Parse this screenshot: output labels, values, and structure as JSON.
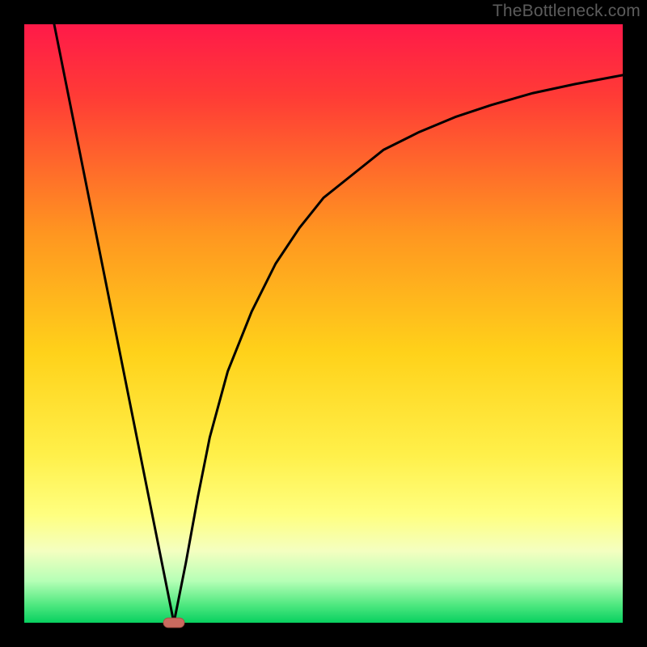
{
  "watermark": "TheBottleneck.com",
  "layout": {
    "outer_w": 800,
    "outer_h": 800,
    "border": 30
  },
  "colors": {
    "frame": "#000000",
    "curve": "#000000",
    "marker_fill": "#c96a5f",
    "marker_stroke": "#aa4f45",
    "gradient": [
      {
        "offset": "0%",
        "color": "#ff1a49"
      },
      {
        "offset": "12%",
        "color": "#ff3b36"
      },
      {
        "offset": "35%",
        "color": "#ff9620"
      },
      {
        "offset": "55%",
        "color": "#ffd21a"
      },
      {
        "offset": "72%",
        "color": "#fff04a"
      },
      {
        "offset": "82%",
        "color": "#ffff80"
      },
      {
        "offset": "88%",
        "color": "#f4ffc0"
      },
      {
        "offset": "93%",
        "color": "#b6ffb6"
      },
      {
        "offset": "97%",
        "color": "#4fe880"
      },
      {
        "offset": "100%",
        "color": "#08d060"
      }
    ]
  },
  "chart_data": {
    "type": "line",
    "title": "",
    "xlabel": "",
    "ylabel": "",
    "xlim": [
      0,
      100
    ],
    "ylim": [
      0,
      100
    ],
    "grid": false,
    "note": "V-shaped bottleneck curve; y≈0 at x≈25 (minimum), high elsewhere. Values are read from pixel positions; axes are unlabeled in the source image.",
    "series": [
      {
        "name": "bottleneck",
        "x": [
          5,
          7,
          9,
          11,
          13,
          15,
          17,
          19,
          21,
          23,
          25,
          27,
          29,
          31,
          34,
          38,
          42,
          46,
          50,
          55,
          60,
          66,
          72,
          78,
          85,
          92,
          100
        ],
        "y": [
          100,
          90,
          80,
          70,
          60,
          50,
          40,
          30,
          20,
          10,
          0,
          10,
          21,
          31,
          42,
          52,
          60,
          66,
          71,
          75,
          79,
          82,
          84.5,
          86.5,
          88.5,
          90,
          91.5
        ]
      }
    ],
    "marker": {
      "x": 25,
      "y": 0,
      "w": 3.5,
      "h": 1.6
    }
  }
}
